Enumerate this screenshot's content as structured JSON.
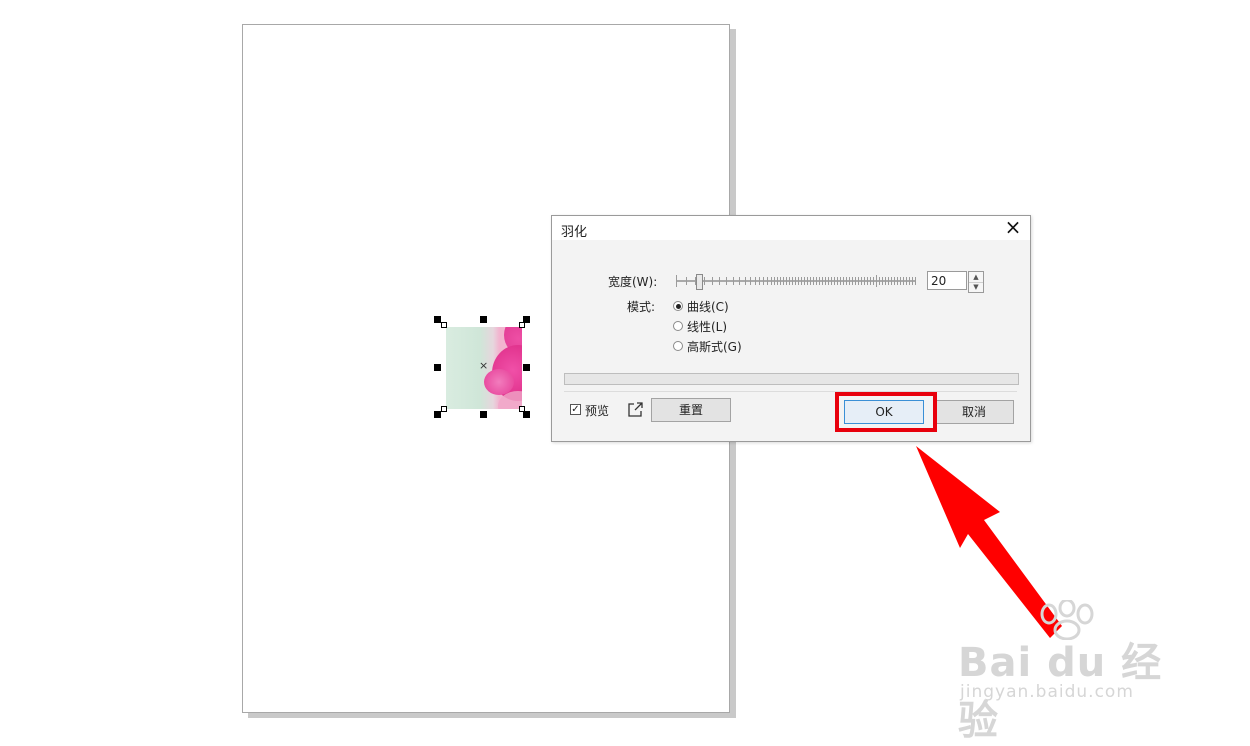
{
  "dialog": {
    "title": "羽化",
    "close_icon": "×",
    "width_label": "宽度(W):",
    "width_value": "20",
    "mode_label": "模式:",
    "modes": [
      {
        "label": "曲线(C)",
        "checked": true
      },
      {
        "label": "线性(L)",
        "checked": false
      },
      {
        "label": "高斯式(G)",
        "checked": false
      }
    ],
    "preview_label": "预览",
    "preview_checked": true,
    "reset_label": "重置",
    "ok_label": "OK",
    "cancel_label": "取消"
  },
  "canvas": {
    "center_mark": "×"
  },
  "watermark": {
    "main": "Bai du 经验",
    "sub": "jingyan.baidu.com"
  },
  "colors": {
    "highlight": "#e8000c",
    "arrow": "#ff0000",
    "flower_pink": "#e2358f",
    "image_green": "#d0e8d9"
  }
}
